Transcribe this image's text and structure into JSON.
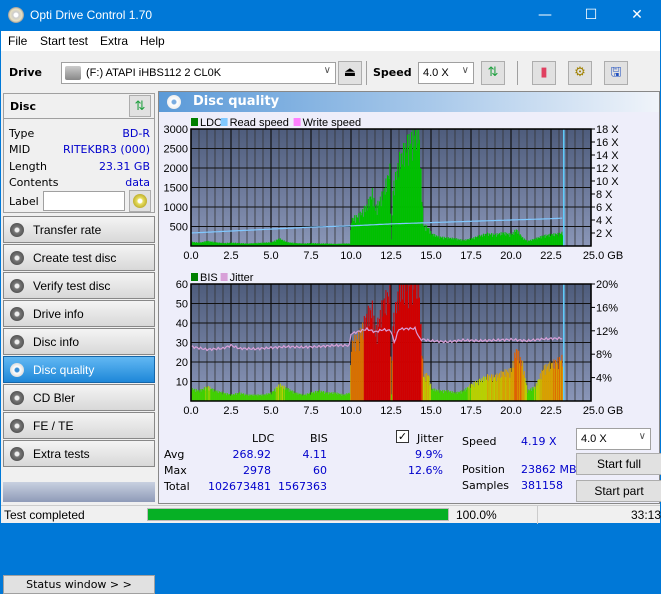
{
  "window": {
    "title": "Opti Drive Control 1.70",
    "minimize": "—",
    "maximize": "☐",
    "close": "✕"
  },
  "menu": [
    "File",
    "Start test",
    "Extra",
    "Help"
  ],
  "toolbar": {
    "drive_label": "Drive",
    "drive_value": "(F:)  ATAPI iHBS112  2 CL0K",
    "speed_label": "Speed",
    "speed_value": "4.0 X"
  },
  "disc": {
    "header": "Disc",
    "rows": [
      {
        "key": "Type",
        "value": "BD-R"
      },
      {
        "key": "MID",
        "value": "RITEKBR3 (000)"
      },
      {
        "key": "Length",
        "value": "23.31 GB"
      },
      {
        "key": "Contents",
        "value": "data"
      }
    ],
    "label_key": "Label",
    "label_value": ""
  },
  "nav": [
    {
      "label": "Transfer rate",
      "active": false
    },
    {
      "label": "Create test disc",
      "active": false
    },
    {
      "label": "Verify test disc",
      "active": false
    },
    {
      "label": "Drive info",
      "active": false
    },
    {
      "label": "Disc info",
      "active": false
    },
    {
      "label": "Disc quality",
      "active": true
    },
    {
      "label": "CD Bler",
      "active": false
    },
    {
      "label": "FE / TE",
      "active": false
    },
    {
      "label": "Extra tests",
      "active": false
    }
  ],
  "status_window_button": "Status window > >",
  "main": {
    "title": "Disc quality"
  },
  "stats": {
    "col_ldc": "LDC",
    "col_bis": "BIS",
    "jitter_label": "Jitter",
    "jitter_checked": true,
    "avg_label": "Avg",
    "max_label": "Max",
    "total_label": "Total",
    "avg_ldc": "268.92",
    "avg_bis": "4.11",
    "avg_jitter": "9.9%",
    "max_ldc": "2978",
    "max_bis": "60",
    "max_jitter": "12.6%",
    "total_ldc": "102673481",
    "total_bis": "1567363",
    "speed_label": "Speed",
    "speed_value": "4.19 X",
    "position_label": "Position",
    "position_value": "23862 MB",
    "samples_label": "Samples",
    "samples_value": "381158",
    "speed_select": "4.0 X",
    "start_full": "Start full",
    "start_part": "Start part"
  },
  "statusbar": {
    "status": "Test completed",
    "progress": 100.0,
    "progress_text": "100.0%",
    "elapsed": "33:13"
  },
  "colors": {
    "ldc": "#00c000",
    "read_speed": "#80c8ff",
    "write_speed": "#ff80ff",
    "bis": "#008000",
    "jitter": "#d8a0d8",
    "plot_bg_top": "#4e5c7c",
    "plot_bg_bottom": "#8a96b8",
    "accent": "#0078d7"
  },
  "chart_data": [
    {
      "type": "area",
      "legend": [
        "LDC",
        "Read speed",
        "Write speed"
      ],
      "xlabel": "GB",
      "xlim": [
        0,
        25
      ],
      "xticks": [
        "0.0",
        "2.5",
        "5.0",
        "7.5",
        "10.0",
        "12.5",
        "15.0",
        "17.5",
        "20.0",
        "22.5",
        "25.0 GB"
      ],
      "ylim_left": [
        0,
        3000
      ],
      "yticks_left": [
        "500",
        "1000",
        "1500",
        "2000",
        "2500",
        "3000"
      ],
      "ylim_right": [
        0,
        18
      ],
      "yticks_right": [
        "2 X",
        "4 X",
        "6 X",
        "8 X",
        "10 X",
        "12 X",
        "14 X",
        "16 X",
        "18 X"
      ],
      "end_marker_gb": 23.3,
      "series": [
        {
          "name": "LDC",
          "x": [
            0,
            0.5,
            1,
            1.5,
            2,
            2.5,
            3,
            3.5,
            4,
            4.5,
            5,
            5.5,
            6,
            6.5,
            7,
            7.5,
            8,
            8.5,
            9,
            9.5,
            9.9,
            10.0,
            10.5,
            11,
            11.3,
            11.5,
            12,
            12.4,
            12.5,
            12.6,
            13,
            13.5,
            14,
            14.2,
            14.5,
            14.8,
            15,
            15.5,
            16,
            16.5,
            17,
            17.5,
            18,
            18.5,
            19,
            19.5,
            20,
            20.3,
            20.7,
            21,
            21.5,
            22,
            22.5,
            23,
            23.3
          ],
          "values": [
            100,
            80,
            120,
            90,
            70,
            80,
            70,
            60,
            70,
            80,
            90,
            180,
            90,
            70,
            60,
            70,
            60,
            60,
            50,
            60,
            60,
            650,
            750,
            1000,
            1300,
            900,
            1300,
            1850,
            150,
            1400,
            2100,
            2500,
            2700,
            2950,
            500,
            450,
            300,
            220,
            200,
            180,
            140,
            180,
            250,
            300,
            280,
            320,
            280,
            400,
            200,
            120,
            180,
            250,
            280,
            300,
            350
          ]
        },
        {
          "name": "Read speed",
          "x": [
            0,
            2.5,
            5,
            7.5,
            10,
            12.5,
            15,
            17.5,
            20,
            22.5,
            23.3
          ],
          "values": [
            2.0,
            2.3,
            2.6,
            2.9,
            3.1,
            3.4,
            3.6,
            3.8,
            4.0,
            4.2,
            4.3
          ]
        }
      ]
    },
    {
      "type": "bar",
      "legend": [
        "BIS",
        "Jitter"
      ],
      "xlabel": "GB",
      "xlim": [
        0,
        25
      ],
      "xticks": [
        "0.0",
        "2.5",
        "5.0",
        "7.5",
        "10.0",
        "12.5",
        "15.0",
        "17.5",
        "20.0",
        "22.5",
        "25.0 GB"
      ],
      "ylim_left": [
        0,
        60
      ],
      "yticks_left": [
        "10",
        "20",
        "30",
        "40",
        "50",
        "60"
      ],
      "ylim_right": [
        0,
        20
      ],
      "yticks_right": [
        "4%",
        "8%",
        "12%",
        "16%",
        "20%"
      ],
      "end_marker_gb": 23.3,
      "series": [
        {
          "name": "BIS",
          "x": [
            0,
            0.5,
            1,
            1.5,
            2,
            2.5,
            3,
            3.5,
            4,
            4.5,
            5,
            5.5,
            6,
            6.5,
            7,
            7.5,
            8,
            8.5,
            9,
            9.5,
            9.9,
            10.0,
            10.5,
            11,
            11.3,
            11.5,
            12,
            12.4,
            12.5,
            12.6,
            13,
            13.5,
            14,
            14.2,
            14.5,
            14.8,
            15,
            15.5,
            16,
            16.5,
            17,
            17.5,
            18,
            18.5,
            19,
            19.5,
            20,
            20.3,
            20.7,
            21,
            21.5,
            22,
            22.5,
            23,
            23.3
          ],
          "values": [
            6,
            5,
            7,
            5,
            4,
            3,
            4,
            3,
            3,
            3,
            4,
            8,
            6,
            4,
            3,
            4,
            5,
            4,
            4,
            3,
            4,
            28,
            32,
            42,
            45,
            33,
            48,
            52,
            3,
            38,
            55,
            58,
            60,
            57,
            12,
            13,
            6,
            5,
            5,
            4,
            5,
            8,
            10,
            12,
            12,
            14,
            15,
            25,
            18,
            5,
            7,
            16,
            18,
            20,
            22
          ]
        },
        {
          "name": "Jitter",
          "x": [
            0,
            1,
            2,
            2.5,
            3,
            4,
            5,
            6,
            7,
            8,
            9,
            9.9,
            10.0,
            11,
            11.5,
            12,
            12.5,
            12.7,
            13,
            14,
            14.3,
            15,
            16,
            17,
            18,
            19,
            20,
            21,
            22,
            23
          ],
          "values": [
            9.3,
            8.8,
            9.0,
            9.5,
            9.0,
            8.9,
            9.1,
            9.3,
            9.2,
            9.3,
            9.5,
            9.5,
            11.5,
            12.3,
            11.8,
            12.2,
            12.0,
            10.0,
            12.3,
            12.4,
            10.6,
            10.3,
            10.1,
            10.4,
            10.3,
            10.4,
            10.5,
            10.3,
            10.6,
            10.7
          ]
        }
      ]
    }
  ]
}
